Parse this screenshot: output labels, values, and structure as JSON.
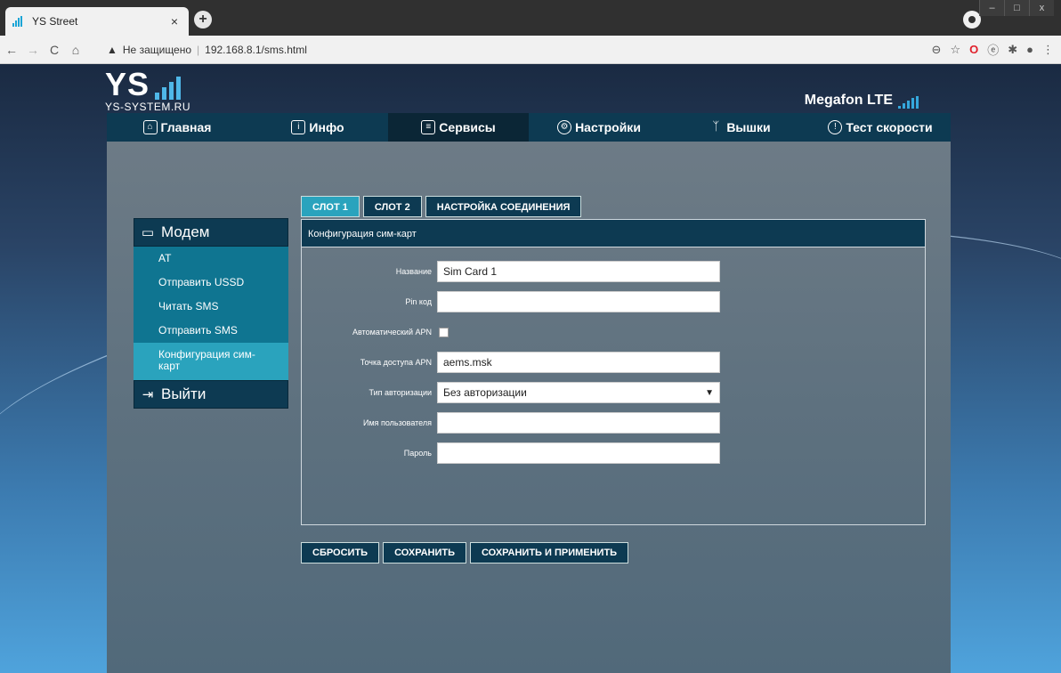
{
  "browser": {
    "tab_title": "YS Street",
    "tab_close": "×",
    "new_tab": "+",
    "not_secure": "Не защищено",
    "url": "192.168.8.1/sms.html",
    "window_controls": [
      "–",
      "□",
      "x"
    ]
  },
  "header": {
    "logo_text": "YS",
    "logo_sub": "YS-SYSTEM.RU",
    "brand": "Megafon LTE"
  },
  "nav": [
    {
      "label": "Главная",
      "icon": "home-icon",
      "glyph": "⌂"
    },
    {
      "label": "Инфо",
      "icon": "info-icon",
      "glyph": "i"
    },
    {
      "label": "Сервисы",
      "icon": "chat-icon",
      "glyph": "≡"
    },
    {
      "label": "Настройки",
      "icon": "gear-icon",
      "glyph": "⚙"
    },
    {
      "label": "Вышки",
      "icon": "antenna-icon",
      "glyph": "ᛉ"
    },
    {
      "label": "Тест скорости",
      "icon": "speed-icon",
      "glyph": "!"
    }
  ],
  "sidebar": {
    "section_title": "Модем",
    "items": [
      "AT",
      "Отправить USSD",
      "Читать SMS",
      "Отправить SMS",
      "Конфигурация сим-карт"
    ],
    "logout": "Выйти"
  },
  "slot_tabs": [
    "СЛОТ 1",
    "СЛОТ 2",
    "НАСТРОЙКА СОЕДИНЕНИЯ"
  ],
  "config": {
    "title": "Конфигурация сим-карт",
    "name_label": "Название",
    "name_value": "Sim Card 1",
    "pin_label": "Pin код",
    "pin_value": "",
    "auto_apn_label": "Автоматический APN",
    "apn_label": "Точка доступа APN",
    "apn_value": "aems.msk",
    "auth_label": "Тип авторизации",
    "auth_value": "Без авторизации",
    "user_label": "Имя пользователя",
    "user_value": "",
    "pass_label": "Пароль",
    "pass_value": ""
  },
  "actions": {
    "reset": "СБРОСИТЬ",
    "save": "СОХРАНИТЬ",
    "save_apply": "СОХРАНИТЬ И ПРИМЕНИТЬ"
  }
}
